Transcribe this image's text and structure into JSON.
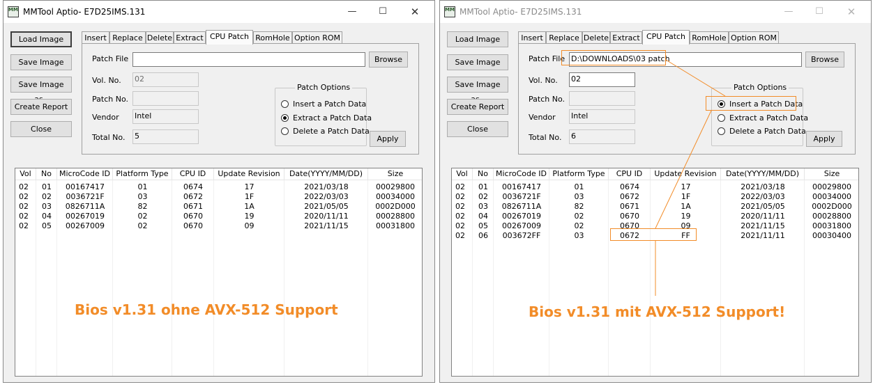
{
  "windows": [
    {
      "title": "MMTool Aptio- E7D25IMS.131",
      "icon_text": "MM",
      "side_buttons": [
        "Load Image",
        "Save Image",
        "Save Image as..",
        "Create Report",
        "Close"
      ],
      "tabs": [
        "Insert",
        "Replace",
        "Delete",
        "Extract",
        "CPU Patch",
        "RomHole",
        "Option ROM"
      ],
      "active_tab": "CPU Patch",
      "labels": {
        "patch_file": "Patch File",
        "vol_no": "Vol. No.",
        "patch_no": "Patch No.",
        "vendor": "Vendor",
        "total_no": "Total No."
      },
      "fields": {
        "patch_file": "",
        "vol_no": "02",
        "patch_no": "",
        "vendor": "Intel",
        "total_no": "5"
      },
      "browse_label": "Browse",
      "apply_label": "Apply",
      "patch_options": {
        "title": "Patch Options",
        "options": [
          "Insert a Patch Data",
          "Extract a Patch Data",
          "Delete a Patch Data"
        ],
        "selected": 1
      },
      "table": {
        "columns": [
          "Vol",
          "No",
          "MicroCode ID",
          "Platform Type",
          "CPU ID",
          "Update Revision",
          "Date(YYYY/MM/DD)",
          "Size"
        ],
        "rows": [
          [
            "02",
            "01",
            "00167417",
            "01",
            "0674",
            "17",
            "2021/03/18",
            "00029800"
          ],
          [
            "02",
            "02",
            "0036721F",
            "03",
            "0672",
            "1F",
            "2022/03/03",
            "00034000"
          ],
          [
            "02",
            "03",
            "0826711A",
            "82",
            "0671",
            "1A",
            "2021/05/05",
            "0002D000"
          ],
          [
            "02",
            "04",
            "00267019",
            "02",
            "0670",
            "19",
            "2020/11/11",
            "00028800"
          ],
          [
            "02",
            "05",
            "00267009",
            "02",
            "0670",
            "09",
            "2021/11/15",
            "00031800"
          ]
        ]
      },
      "caption": "Bios v1.31 ohne AVX-512 Support"
    },
    {
      "title": "MMTool Aptio- E7D25IMS.131",
      "icon_text": "MM",
      "side_buttons": [
        "Load Image",
        "Save Image",
        "Save Image as..",
        "Create Report",
        "Close"
      ],
      "tabs": [
        "Insert",
        "Replace",
        "Delete",
        "Extract",
        "CPU Patch",
        "RomHole",
        "Option ROM"
      ],
      "active_tab": "CPU Patch",
      "labels": {
        "patch_file": "Patch File",
        "vol_no": "Vol. No.",
        "patch_no": "Patch No.",
        "vendor": "Vendor",
        "total_no": "Total No."
      },
      "fields": {
        "patch_file": "D:\\DOWNLOADS\\03 patch",
        "vol_no": "02",
        "patch_no": "",
        "vendor": "Intel",
        "total_no": "6"
      },
      "browse_label": "Browse",
      "apply_label": "Apply",
      "patch_options": {
        "title": "Patch Options",
        "options": [
          "Insert a Patch Data",
          "Extract a Patch Data",
          "Delete a Patch Data"
        ],
        "selected": 0
      },
      "table": {
        "columns": [
          "Vol",
          "No",
          "MicroCode ID",
          "Platform Type",
          "CPU ID",
          "Update Revision",
          "Date(YYYY/MM/DD)",
          "Size"
        ],
        "rows": [
          [
            "02",
            "01",
            "00167417",
            "01",
            "0674",
            "17",
            "2021/03/18",
            "00029800"
          ],
          [
            "02",
            "02",
            "0036721F",
            "03",
            "0672",
            "1F",
            "2022/03/03",
            "00034000"
          ],
          [
            "02",
            "03",
            "0826711A",
            "82",
            "0671",
            "1A",
            "2021/05/05",
            "0002D000"
          ],
          [
            "02",
            "04",
            "00267019",
            "02",
            "0670",
            "19",
            "2020/11/11",
            "00028800"
          ],
          [
            "02",
            "05",
            "00267009",
            "02",
            "0670",
            "09",
            "2021/11/15",
            "00031800"
          ],
          [
            "02",
            "06",
            "003672FF",
            "03",
            "0672",
            "FF",
            "2021/11/11",
            "00030400"
          ]
        ]
      },
      "caption": "Bios v1.31 mit AVX-512 Support!"
    }
  ],
  "colors": {
    "annotation": "#f28c28",
    "window_bg": "#f0f0f0"
  }
}
